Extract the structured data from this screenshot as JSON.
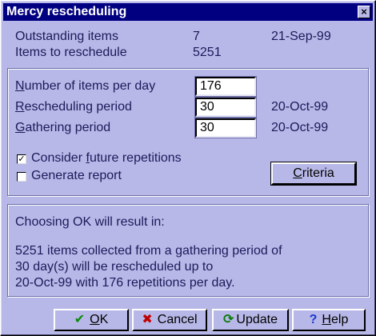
{
  "window": {
    "title": "Mercy rescheduling",
    "close_glyph": "×"
  },
  "summary": {
    "outstanding_label": "Outstanding items",
    "outstanding_value": "7",
    "outstanding_date": "21-Sep-99",
    "to_reschedule_label": "Items to reschedule",
    "to_reschedule_value": "5251"
  },
  "settings": {
    "per_day_label_u": "N",
    "per_day_label_rest": "umber of items per day",
    "per_day_value": "176",
    "period_label_u": "R",
    "period_label_rest": "escheduling period",
    "period_value": "30",
    "period_date": "20-Oct-99",
    "gathering_label_u": "G",
    "gathering_label_rest": "athering period",
    "gathering_value": "30",
    "gathering_date": "20-Oct-99",
    "future_label_a": "Consider ",
    "future_label_u": "f",
    "future_label_b": "uture repetitions",
    "future_checked": true,
    "check_glyph": "✓",
    "report_label": "Generate report",
    "report_checked": false,
    "criteria_label_u": "C",
    "criteria_label_rest": "riteria"
  },
  "result": {
    "heading": "Choosing OK will result in:",
    "line1": "5251 items collected from a gathering period of",
    "line2": "30 day(s) will be rescheduled up to",
    "line3": "20-Oct-99 with 176 repetitions per day."
  },
  "buttons": {
    "ok_u": "O",
    "ok_rest": "K",
    "ok_icon": "✔",
    "cancel_label": "Cancel",
    "cancel_icon": "✖",
    "update_label": "Update",
    "update_icon": "⟳",
    "help_u": "H",
    "help_rest": "elp",
    "help_icon": "?"
  },
  "colors": {
    "background": "#b8b8e8",
    "titlebar": "#000080",
    "text": "#1a1a5a",
    "ok_icon": "#0a8a0a",
    "cancel_icon": "#c00000",
    "update_icon": "#0a7a0a",
    "help_icon": "#1a3acc"
  }
}
